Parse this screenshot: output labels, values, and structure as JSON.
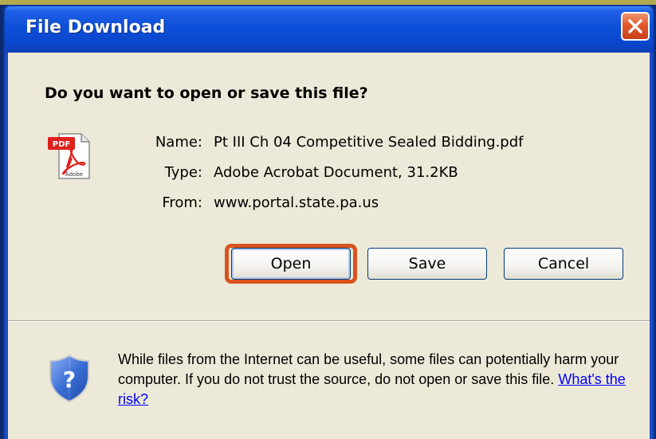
{
  "window": {
    "title": "File Download"
  },
  "dialog": {
    "question": "Do you want to open or save this file?",
    "file_icon": "pdf-file-icon",
    "file_icon_label": "PDF",
    "file_icon_caption": "Adobe",
    "fields": [
      {
        "label": "Name:",
        "value": "Pt III Ch 04 Competitive Sealed Bidding.pdf"
      },
      {
        "label": "Type:",
        "value": "Adobe Acrobat Document, 31.2KB"
      },
      {
        "label": "From:",
        "value": "www.portal.state.pa.us"
      }
    ],
    "buttons": {
      "open": "Open",
      "save": "Save",
      "cancel": "Cancel"
    },
    "warning_icon": "shield-question-icon",
    "warning_text": "While files from the Internet can be useful, some files can potentially harm your computer. If you do not trust the source, do not open or save this file.",
    "risk_link": "What's the risk?"
  },
  "colors": {
    "titlebar": "#0a47cc",
    "dialog_bg": "#ece9d8",
    "highlight": "#d9531e",
    "link": "#0000ff",
    "close_button": "#e2592e"
  }
}
